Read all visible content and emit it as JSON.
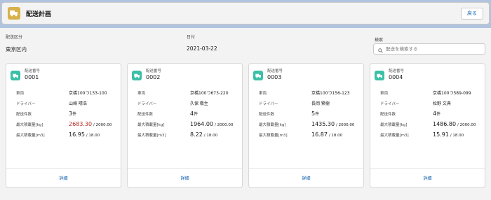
{
  "header": {
    "title": "配送計画",
    "back_label": "戻る"
  },
  "filters": {
    "area_label": "配送区分",
    "area_value": "東京区内",
    "date_label": "日付",
    "date_value": "2021-03-22",
    "search_label": "検索",
    "search_placeholder": "配送を検索する"
  },
  "field_labels": {
    "delivery_no": "配送番号",
    "vehicle": "車両",
    "driver": "ドライバー",
    "count": "配送件数",
    "max_weight": "最大積載量[kg]",
    "max_volume": "最大積載量[m3]",
    "detail": "詳細"
  },
  "cards": [
    {
      "no": "0001",
      "vehicle": "京橋100つ133-100",
      "driver": "山崎 晴浩",
      "count": "3",
      "count_unit": "件",
      "weight": "2683.30",
      "weight_max": "/ 2000.00",
      "weight_over": true,
      "volume": "16.95",
      "volume_max": "/ 18.00"
    },
    {
      "no": "0002",
      "vehicle": "京橋100つ673-220",
      "driver": "久保 敬生",
      "count": "4",
      "count_unit": "件",
      "weight": "1964.00",
      "weight_max": "/ 2000.00",
      "weight_over": false,
      "volume": "8.22",
      "volume_max": "/ 18.00"
    },
    {
      "no": "0003",
      "vehicle": "京橋100つ156-123",
      "driver": "長岡 繁樹",
      "count": "5",
      "count_unit": "件",
      "weight": "1435.30",
      "weight_max": "/ 2000.00",
      "weight_over": false,
      "volume": "16.87",
      "volume_max": "/ 18.00"
    },
    {
      "no": "0004",
      "vehicle": "京橋100つ589-099",
      "driver": "松野 文典",
      "count": "4",
      "count_unit": "件",
      "weight": "1486.80",
      "weight_max": "/ 2000.00",
      "weight_over": false,
      "volume": "15.91",
      "volume_max": "/ 18.00"
    }
  ],
  "colors": {
    "app_icon": "#d8b14a",
    "card_icon": "#3bbfa7",
    "over_weight": "#b52b22",
    "link": "#0b5cab"
  },
  "icons": {
    "app": "truck-icon",
    "card": "truck-icon",
    "search": "search-icon"
  }
}
